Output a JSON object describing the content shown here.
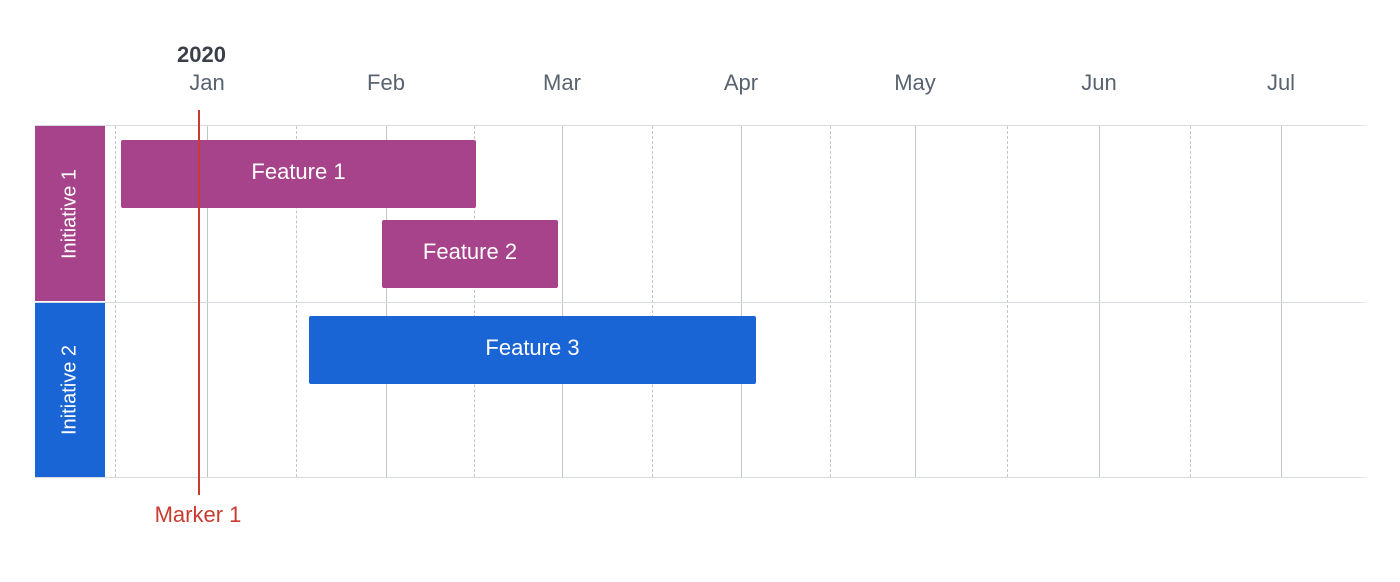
{
  "chart_data": {
    "type": "bar",
    "title": "",
    "xlabel": "",
    "ylabel": "",
    "year": "2020",
    "categories": [
      "Jan",
      "Feb",
      "Mar",
      "Apr",
      "May",
      "Jun",
      "Jul"
    ],
    "x_range": [
      "2019-12-20",
      "2020-08-01"
    ],
    "series": [
      {
        "name": "Initiative 1",
        "color": "#a7438a",
        "items": [
          {
            "name": "Feature 1",
            "start": "2019-12-27",
            "end": "2020-02-16"
          },
          {
            "name": "Feature 2",
            "start": "2020-02-04",
            "end": "2020-03-05"
          }
        ]
      },
      {
        "name": "Initiative 2",
        "color": "#1a65d6",
        "items": [
          {
            "name": "Feature 3",
            "start": "2020-01-22",
            "end": "2020-04-09"
          }
        ]
      }
    ],
    "markers": [
      {
        "name": "Marker 1",
        "date": "2020-01-01",
        "color": "#c83b2e"
      }
    ]
  },
  "year": "2020",
  "months": {
    "m0": "Jan",
    "m1": "Feb",
    "m2": "Mar",
    "m3": "Apr",
    "m4": "May",
    "m5": "Jun",
    "m6": "Jul"
  },
  "lanes": {
    "l0": {
      "name": "Initiative 1",
      "color": "#a7438a"
    },
    "l1": {
      "name": "Initiative 2",
      "color": "#1a65d6"
    }
  },
  "bars": {
    "b0": {
      "label": "Feature 1",
      "color": "#a7438a"
    },
    "b1": {
      "label": "Feature 2",
      "color": "#a7438a"
    },
    "b2": {
      "label": "Feature 3",
      "color": "#1a65d6"
    }
  },
  "marker": {
    "label": "Marker 1",
    "color": "#c83b2e"
  }
}
